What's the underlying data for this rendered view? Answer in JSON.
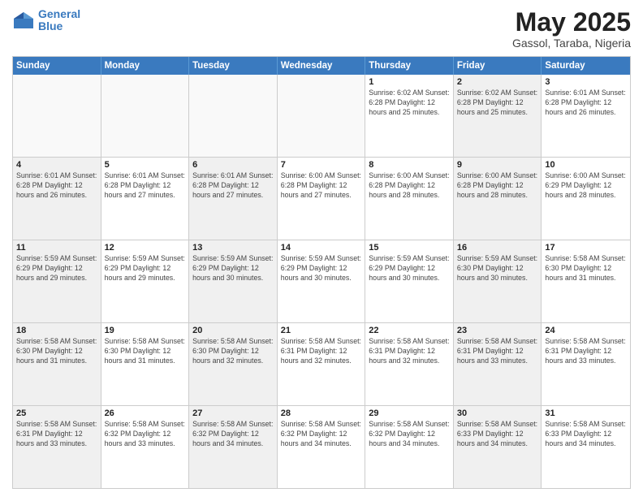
{
  "logo": {
    "line1": "General",
    "line2": "Blue"
  },
  "title": "May 2025",
  "subtitle": "Gassol, Taraba, Nigeria",
  "days_of_week": [
    "Sunday",
    "Monday",
    "Tuesday",
    "Wednesday",
    "Thursday",
    "Friday",
    "Saturday"
  ],
  "weeks": [
    [
      {
        "day": "",
        "info": "",
        "shaded": false,
        "empty": true
      },
      {
        "day": "",
        "info": "",
        "shaded": false,
        "empty": true
      },
      {
        "day": "",
        "info": "",
        "shaded": false,
        "empty": true
      },
      {
        "day": "",
        "info": "",
        "shaded": false,
        "empty": true
      },
      {
        "day": "1",
        "info": "Sunrise: 6:02 AM\nSunset: 6:28 PM\nDaylight: 12 hours\nand 25 minutes.",
        "shaded": false,
        "empty": false
      },
      {
        "day": "2",
        "info": "Sunrise: 6:02 AM\nSunset: 6:28 PM\nDaylight: 12 hours\nand 25 minutes.",
        "shaded": true,
        "empty": false
      },
      {
        "day": "3",
        "info": "Sunrise: 6:01 AM\nSunset: 6:28 PM\nDaylight: 12 hours\nand 26 minutes.",
        "shaded": false,
        "empty": false
      }
    ],
    [
      {
        "day": "4",
        "info": "Sunrise: 6:01 AM\nSunset: 6:28 PM\nDaylight: 12 hours\nand 26 minutes.",
        "shaded": true,
        "empty": false
      },
      {
        "day": "5",
        "info": "Sunrise: 6:01 AM\nSunset: 6:28 PM\nDaylight: 12 hours\nand 27 minutes.",
        "shaded": false,
        "empty": false
      },
      {
        "day": "6",
        "info": "Sunrise: 6:01 AM\nSunset: 6:28 PM\nDaylight: 12 hours\nand 27 minutes.",
        "shaded": true,
        "empty": false
      },
      {
        "day": "7",
        "info": "Sunrise: 6:00 AM\nSunset: 6:28 PM\nDaylight: 12 hours\nand 27 minutes.",
        "shaded": false,
        "empty": false
      },
      {
        "day": "8",
        "info": "Sunrise: 6:00 AM\nSunset: 6:28 PM\nDaylight: 12 hours\nand 28 minutes.",
        "shaded": false,
        "empty": false
      },
      {
        "day": "9",
        "info": "Sunrise: 6:00 AM\nSunset: 6:28 PM\nDaylight: 12 hours\nand 28 minutes.",
        "shaded": true,
        "empty": false
      },
      {
        "day": "10",
        "info": "Sunrise: 6:00 AM\nSunset: 6:29 PM\nDaylight: 12 hours\nand 28 minutes.",
        "shaded": false,
        "empty": false
      }
    ],
    [
      {
        "day": "11",
        "info": "Sunrise: 5:59 AM\nSunset: 6:29 PM\nDaylight: 12 hours\nand 29 minutes.",
        "shaded": true,
        "empty": false
      },
      {
        "day": "12",
        "info": "Sunrise: 5:59 AM\nSunset: 6:29 PM\nDaylight: 12 hours\nand 29 minutes.",
        "shaded": false,
        "empty": false
      },
      {
        "day": "13",
        "info": "Sunrise: 5:59 AM\nSunset: 6:29 PM\nDaylight: 12 hours\nand 30 minutes.",
        "shaded": true,
        "empty": false
      },
      {
        "day": "14",
        "info": "Sunrise: 5:59 AM\nSunset: 6:29 PM\nDaylight: 12 hours\nand 30 minutes.",
        "shaded": false,
        "empty": false
      },
      {
        "day": "15",
        "info": "Sunrise: 5:59 AM\nSunset: 6:29 PM\nDaylight: 12 hours\nand 30 minutes.",
        "shaded": false,
        "empty": false
      },
      {
        "day": "16",
        "info": "Sunrise: 5:59 AM\nSunset: 6:30 PM\nDaylight: 12 hours\nand 30 minutes.",
        "shaded": true,
        "empty": false
      },
      {
        "day": "17",
        "info": "Sunrise: 5:58 AM\nSunset: 6:30 PM\nDaylight: 12 hours\nand 31 minutes.",
        "shaded": false,
        "empty": false
      }
    ],
    [
      {
        "day": "18",
        "info": "Sunrise: 5:58 AM\nSunset: 6:30 PM\nDaylight: 12 hours\nand 31 minutes.",
        "shaded": true,
        "empty": false
      },
      {
        "day": "19",
        "info": "Sunrise: 5:58 AM\nSunset: 6:30 PM\nDaylight: 12 hours\nand 31 minutes.",
        "shaded": false,
        "empty": false
      },
      {
        "day": "20",
        "info": "Sunrise: 5:58 AM\nSunset: 6:30 PM\nDaylight: 12 hours\nand 32 minutes.",
        "shaded": true,
        "empty": false
      },
      {
        "day": "21",
        "info": "Sunrise: 5:58 AM\nSunset: 6:31 PM\nDaylight: 12 hours\nand 32 minutes.",
        "shaded": false,
        "empty": false
      },
      {
        "day": "22",
        "info": "Sunrise: 5:58 AM\nSunset: 6:31 PM\nDaylight: 12 hours\nand 32 minutes.",
        "shaded": false,
        "empty": false
      },
      {
        "day": "23",
        "info": "Sunrise: 5:58 AM\nSunset: 6:31 PM\nDaylight: 12 hours\nand 33 minutes.",
        "shaded": true,
        "empty": false
      },
      {
        "day": "24",
        "info": "Sunrise: 5:58 AM\nSunset: 6:31 PM\nDaylight: 12 hours\nand 33 minutes.",
        "shaded": false,
        "empty": false
      }
    ],
    [
      {
        "day": "25",
        "info": "Sunrise: 5:58 AM\nSunset: 6:31 PM\nDaylight: 12 hours\nand 33 minutes.",
        "shaded": true,
        "empty": false
      },
      {
        "day": "26",
        "info": "Sunrise: 5:58 AM\nSunset: 6:32 PM\nDaylight: 12 hours\nand 33 minutes.",
        "shaded": false,
        "empty": false
      },
      {
        "day": "27",
        "info": "Sunrise: 5:58 AM\nSunset: 6:32 PM\nDaylight: 12 hours\nand 34 minutes.",
        "shaded": true,
        "empty": false
      },
      {
        "day": "28",
        "info": "Sunrise: 5:58 AM\nSunset: 6:32 PM\nDaylight: 12 hours\nand 34 minutes.",
        "shaded": false,
        "empty": false
      },
      {
        "day": "29",
        "info": "Sunrise: 5:58 AM\nSunset: 6:32 PM\nDaylight: 12 hours\nand 34 minutes.",
        "shaded": false,
        "empty": false
      },
      {
        "day": "30",
        "info": "Sunrise: 5:58 AM\nSunset: 6:33 PM\nDaylight: 12 hours\nand 34 minutes.",
        "shaded": true,
        "empty": false
      },
      {
        "day": "31",
        "info": "Sunrise: 5:58 AM\nSunset: 6:33 PM\nDaylight: 12 hours\nand 34 minutes.",
        "shaded": false,
        "empty": false
      }
    ]
  ]
}
